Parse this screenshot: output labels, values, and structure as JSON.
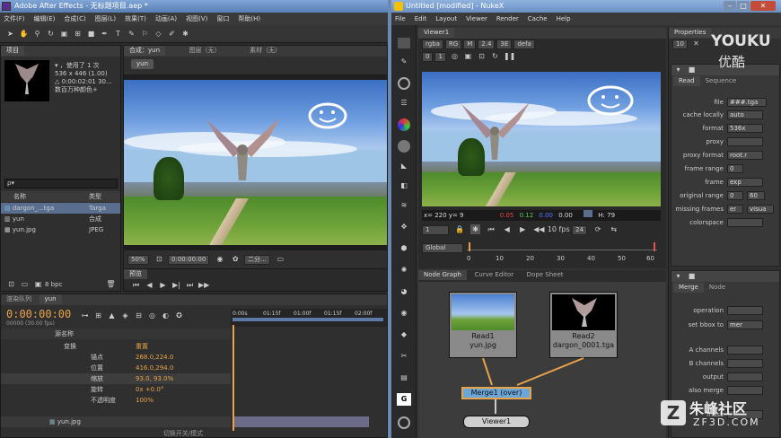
{
  "ae": {
    "title": "Adobe After Effects - 无标题项目.aep *",
    "menu": [
      "文件(F)",
      "编辑(E)",
      "合成(C)",
      "图层(L)",
      "效果(T)",
      "动画(A)",
      "视图(V)",
      "窗口",
      "帮助(H)"
    ],
    "project_tab": "项目",
    "project_info": [
      "▾ ，使用了 1 次",
      "536 x 446 (1.00)",
      "△ 0:00:02:01 30...",
      "数百万种颜色+"
    ],
    "search_placeholder": "ρ▾",
    "list_header": {
      "name": "名称",
      "type": "类型"
    },
    "items": [
      {
        "name": "dargon_...tga",
        "type": "Targa"
      },
      {
        "name": "yun",
        "type": "合成"
      },
      {
        "name": "yun.jpg",
        "type": "JPEG"
      }
    ],
    "bpc": "8 bpc",
    "comp_tab": "合成：yun",
    "layer_tab": "图层（无）",
    "footage_tab": "素材（无）",
    "comp_subtab": "yun",
    "zoom": "50%",
    "timecode_small": "0:00:00:00",
    "quality": "二分...",
    "preview_tab": "预览",
    "timeline_tabs": [
      "渲染队列",
      "yun"
    ],
    "timecode": "0:00:00:00",
    "fps_note": "00000 (30.00 fps)",
    "ruler": [
      "0:00s",
      "01:15f",
      "01:00f",
      "01:15f",
      "02:00f"
    ],
    "layer_col": "源名称",
    "props": [
      {
        "label": "变换",
        "value": "重置"
      },
      {
        "label": "锚点",
        "value": "268.0,224.0"
      },
      {
        "label": "位置",
        "value": "416.0,294.0"
      },
      {
        "label": "缩放",
        "value": "93.0, 93.0%"
      },
      {
        "label": "旋转",
        "value": "0x +0.0°"
      },
      {
        "label": "不透明度",
        "value": "100%"
      }
    ],
    "bottom_layer": "yun.jpg",
    "bottom_switch": "切换开关/模式"
  },
  "nuke": {
    "title": "Untitled [modified] - NukeX",
    "menu": [
      "File",
      "Edit",
      "Layout",
      "Viewer",
      "Render",
      "Cache",
      "Help"
    ],
    "viewer_tab": "Viewer1",
    "channels": "rgba",
    "rgb": "RG",
    "m": "M",
    "gain": "2.4",
    "gamma": "3E",
    "default": "defa",
    "zero": "0",
    "one": "1",
    "info_xy": "x= 220 y= 9",
    "info_vals": [
      "0.05",
      "0.12",
      "0.00",
      "0.00"
    ],
    "info_h": "H: 79",
    "frame": "1",
    "fps": "10 fps",
    "fps_num": "24",
    "global": "Global",
    "timeline_ticks": [
      "0",
      "10",
      "20",
      "30",
      "40",
      "50",
      "60"
    ],
    "end_frame": "60",
    "graph_tabs": [
      "Node Graph",
      "Curve Editor",
      "Dope Sheet"
    ],
    "nodes": {
      "read1": [
        "Read1",
        "yun.jpg"
      ],
      "read2": [
        "Read2",
        "dargon_0001.tga"
      ],
      "merge": "Merge1 (over)",
      "viewer": "Viewer1"
    },
    "properties_tab": "Properties",
    "prop_count": "10",
    "read_panel": {
      "tabs": [
        "Read",
        "Sequence"
      ],
      "fields": [
        {
          "label": "file",
          "value": "###.tga"
        },
        {
          "label": "cache locally",
          "value": "auto"
        },
        {
          "label": "format",
          "value": "536x"
        },
        {
          "label": "proxy",
          "value": ""
        },
        {
          "label": "proxy format",
          "value": "root.r"
        },
        {
          "label": "frame range",
          "value": "0"
        },
        {
          "label": "frame",
          "value": "exp"
        },
        {
          "label": "original range",
          "value": "0"
        },
        {
          "label": "missing frames",
          "value": "er"
        },
        {
          "label": "colorspace",
          "value": ""
        }
      ],
      "frame_end": "60",
      "orig_end": "60",
      "missing_extra": "visua"
    },
    "merge_panel": {
      "tabs": [
        "Merge",
        "Node"
      ],
      "fields": [
        {
          "label": "operation",
          "value": ""
        },
        {
          "label": "set bbox to",
          "value": "mer"
        },
        {
          "label": "A channels",
          "value": ""
        },
        {
          "label": "B channels",
          "value": ""
        },
        {
          "label": "output",
          "value": ""
        },
        {
          "label": "also merge",
          "value": ""
        },
        {
          "label": "mask",
          "value": ""
        }
      ]
    }
  },
  "watermarks": {
    "youku1": "YOUKU",
    "youku2": "优酷",
    "zf3d": "朱峰社区",
    "zf3d_url": "ZF3D.COM"
  }
}
